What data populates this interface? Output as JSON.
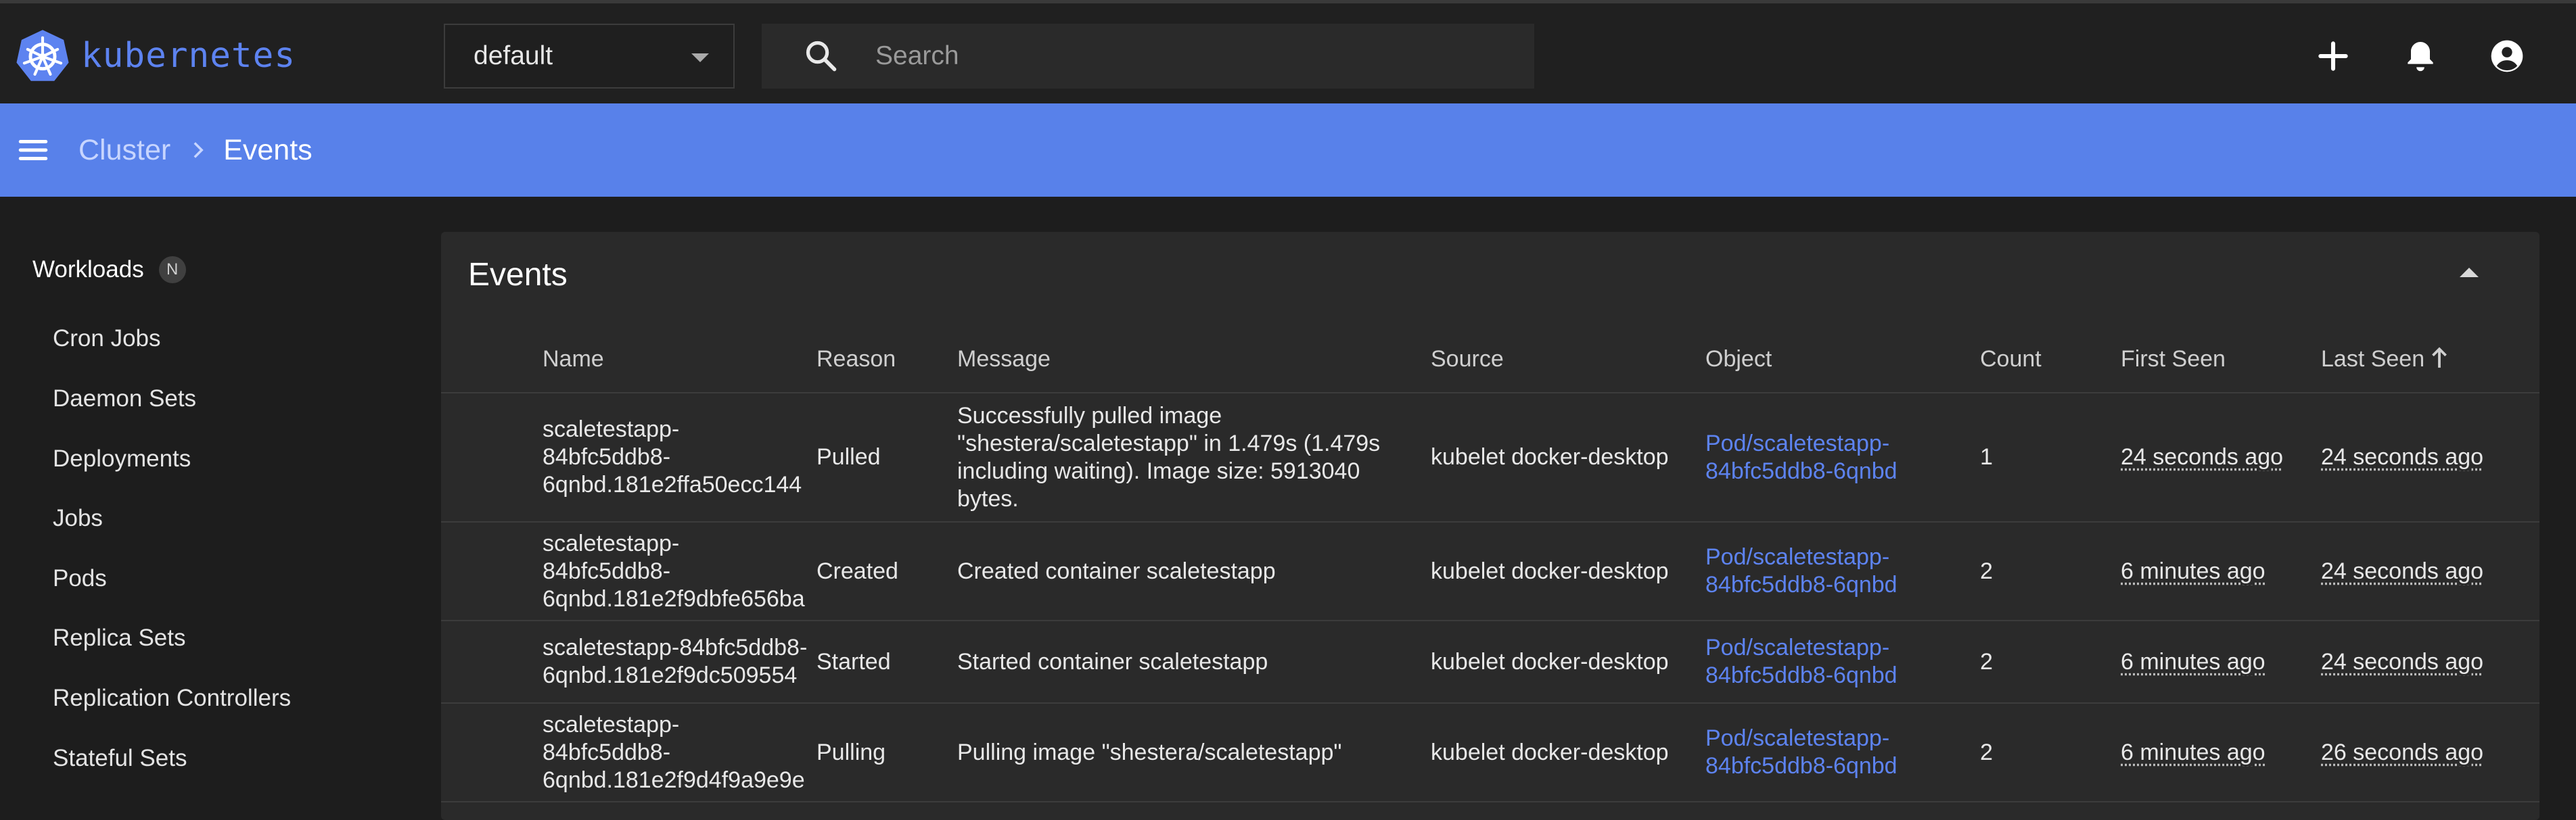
{
  "brand": {
    "name": "kubernetes",
    "logo_icon": "kubernetes-helm-icon"
  },
  "namespace": {
    "selected": "default"
  },
  "search": {
    "placeholder": "Search"
  },
  "breadcrumb": {
    "parent": "Cluster",
    "current": "Events"
  },
  "sidebar": {
    "section": "Workloads",
    "badge": "N",
    "items": [
      {
        "label": "Cron Jobs"
      },
      {
        "label": "Daemon Sets"
      },
      {
        "label": "Deployments"
      },
      {
        "label": "Jobs"
      },
      {
        "label": "Pods"
      },
      {
        "label": "Replica Sets"
      },
      {
        "label": "Replication Controllers"
      },
      {
        "label": "Stateful Sets"
      }
    ]
  },
  "events": {
    "title": "Events",
    "columns": [
      "Name",
      "Reason",
      "Message",
      "Source",
      "Object",
      "Count",
      "First Seen",
      "Last Seen"
    ],
    "sort": {
      "column": "Last Seen",
      "direction": "ascending"
    },
    "rows": [
      {
        "name": [
          "scaletestapp-",
          "84bfc5ddb8-",
          "6qnbd.181e2ffa50ecc144"
        ],
        "reason": "Pulled",
        "message": [
          "Successfully pulled image",
          "\"shestera/scaletestapp\" in 1.479s (1.479s",
          "including waiting). Image size: 5913040",
          "bytes."
        ],
        "source": "kubelet docker-desktop",
        "object": [
          "Pod/scaletestapp-",
          "84bfc5ddb8-6qnbd"
        ],
        "count": "1",
        "first_seen": "24 seconds ago",
        "last_seen": "24 seconds ago"
      },
      {
        "name": [
          "scaletestapp-",
          "84bfc5ddb8-",
          "6qnbd.181e2f9dbfe656ba"
        ],
        "reason": "Created",
        "message": [
          "Created container scaletestapp"
        ],
        "source": "kubelet docker-desktop",
        "object": [
          "Pod/scaletestapp-",
          "84bfc5ddb8-6qnbd"
        ],
        "count": "2",
        "first_seen": "6 minutes ago",
        "last_seen": "24 seconds ago"
      },
      {
        "name": [
          "scaletestapp-84bfc5ddb8-",
          "6qnbd.181e2f9dc509554"
        ],
        "reason": "Started",
        "message": [
          "Started container scaletestapp"
        ],
        "source": "kubelet docker-desktop",
        "object": [
          "Pod/scaletestapp-",
          "84bfc5ddb8-6qnbd"
        ],
        "count": "2",
        "first_seen": "6 minutes ago",
        "last_seen": "24 seconds ago"
      },
      {
        "name": [
          "scaletestapp-",
          "84bfc5ddb8-",
          "6qnbd.181e2f9d4f9a9e9e"
        ],
        "reason": "Pulling",
        "message": [
          "Pulling image \"shestera/scaletestapp\""
        ],
        "source": "kubelet docker-desktop",
        "object": [
          "Pod/scaletestapp-",
          "84bfc5ddb8-6qnbd"
        ],
        "count": "2",
        "first_seen": "6 minutes ago",
        "last_seen": "26 seconds ago"
      }
    ]
  },
  "colors": {
    "accent": "#5881ea",
    "link": "#5d83f0",
    "background": "#1d1d1d",
    "card": "#2a2a2a"
  }
}
